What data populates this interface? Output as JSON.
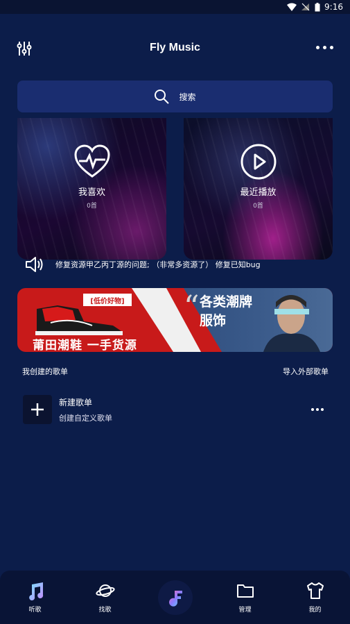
{
  "status_bar": {
    "time": "9:16"
  },
  "header": {
    "title": "Fly Music"
  },
  "search": {
    "placeholder": "搜索"
  },
  "cards": [
    {
      "name": "我喜欢",
      "count": "0首",
      "icon": "heart-pulse-icon"
    },
    {
      "name": "最近播放",
      "count": "0首",
      "icon": "play-circle-icon"
    }
  ],
  "notice": {
    "text": "修复资源甲乙丙丁源的问题; （非常多资源了） 修复已知bug"
  },
  "banner": {
    "tag": "[低价好物]",
    "slogan": "莆田潮鞋  一手货源",
    "headline_line1": "各类潮牌",
    "headline_line2": "服饰"
  },
  "section": {
    "my_playlists": "我创建的歌单",
    "import": "导入外部歌单"
  },
  "playlist": {
    "title": "新建歌单",
    "subtitle": "创建自定义歌单"
  },
  "tabs": [
    {
      "label": "听歌",
      "icon": "music-note-icon"
    },
    {
      "label": "找歌",
      "icon": "planet-icon"
    },
    {
      "label": "",
      "icon": "app-logo-icon"
    },
    {
      "label": "管理",
      "icon": "folder-icon"
    },
    {
      "label": "我的",
      "icon": "tshirt-icon"
    }
  ],
  "colors": {
    "background": "#0c1d4a",
    "search_bg": "#1a2d70",
    "tabbar": "#091436",
    "banner_red": "#c81a1a"
  }
}
